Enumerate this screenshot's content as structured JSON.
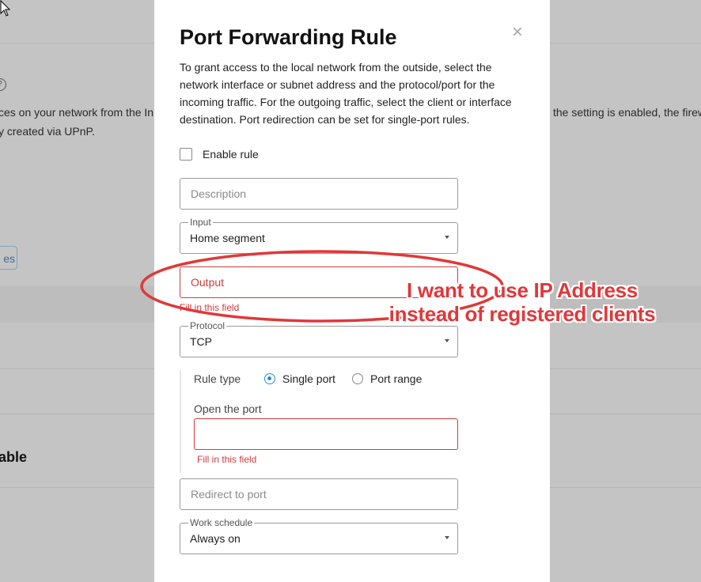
{
  "background": {
    "line1_left": "ces on your network from the In",
    "line1_right": "the setting is enabled, the firew",
    "line2": "y created via UPnP.",
    "button_label": "es",
    "heading": "able",
    "help_icon": "?"
  },
  "modal": {
    "title": "Port Forwarding Rule",
    "close_icon": "×",
    "intro": "To grant access to the local network from the outside, select the network interface or subnet address and the protocol/port for the incoming traffic. For the outgoing traffic, select the client or interface destination. Port redirection can be set for single-port rules.",
    "enable_rule_label": "Enable rule",
    "enable_rule_checked": false,
    "description_placeholder": "Description",
    "input_legend": "Input",
    "input_value": "Home segment",
    "output_placeholder": "Output",
    "output_error": "Fill in this field",
    "protocol_legend": "Protocol",
    "protocol_value": "TCP",
    "rule_type_label": "Rule type",
    "rule_type_options": [
      "Single port",
      "Port range"
    ],
    "rule_type_selected": "Single port",
    "open_port_label": "Open the port",
    "open_port_value": "",
    "open_port_error": "Fill in this field",
    "redirect_placeholder": "Redirect to port",
    "schedule_legend": "Work schedule",
    "schedule_value": "Always on"
  },
  "annotation": {
    "line1": "I want to use IP Address",
    "line2": "instead of registered clients",
    "color": "#e0383a"
  },
  "colors": {
    "error": "#d23b3b",
    "radio_accent": "#2c8ad6",
    "overlay": "#c4c4c4"
  }
}
